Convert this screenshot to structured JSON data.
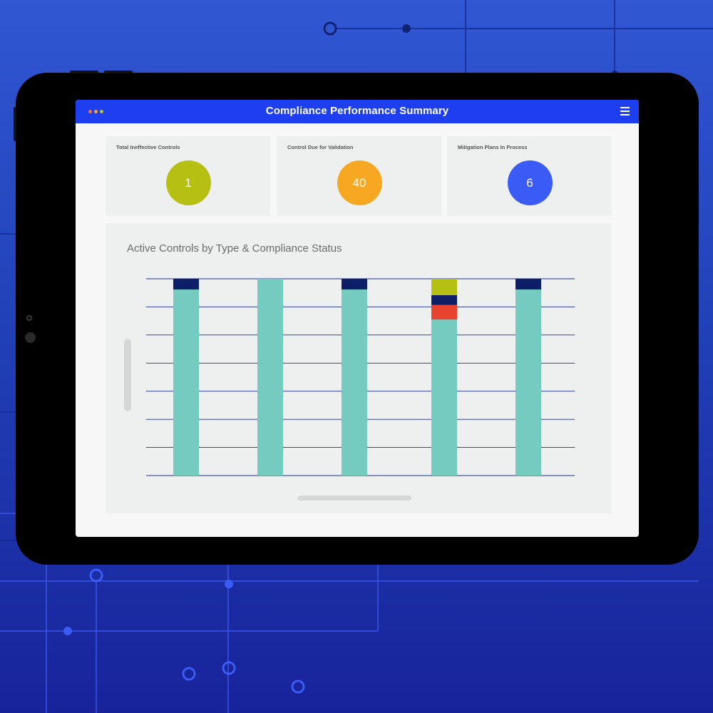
{
  "window": {
    "title": "Compliance Performance Summary",
    "dots": [
      "#e8734a",
      "#f2a23c",
      "#b5c234"
    ],
    "menu_icon": "hamburger-menu-icon"
  },
  "kpis": [
    {
      "label": "Total Ineffective Controls",
      "value": "1",
      "color": "#b6c012"
    },
    {
      "label": "Control Due for Validation",
      "value": "40",
      "color": "#f7a823"
    },
    {
      "label": "Mitigation Plans In Process",
      "value": "6",
      "color": "#3b5bf6"
    }
  ],
  "chart_data": {
    "type": "bar",
    "stacked": true,
    "title": "Active Controls by Type & Compliance Status",
    "xlabel": "",
    "ylabel": "",
    "categories": [
      "",
      "",
      "",
      "",
      ""
    ],
    "ylim": [
      0,
      7
    ],
    "grid": true,
    "series": [
      {
        "color": "#76cbc1",
        "values": [
          6.62,
          7.0,
          6.62,
          5.55,
          6.62
        ]
      },
      {
        "color": "#e8432f",
        "values": [
          0,
          0,
          0,
          0.52,
          0
        ]
      },
      {
        "color": "#0d1f66",
        "values": [
          0.38,
          0,
          0.38,
          0.35,
          0.38
        ]
      },
      {
        "color": "#b6c012",
        "values": [
          0,
          0,
          0,
          0.58,
          0
        ]
      }
    ]
  }
}
